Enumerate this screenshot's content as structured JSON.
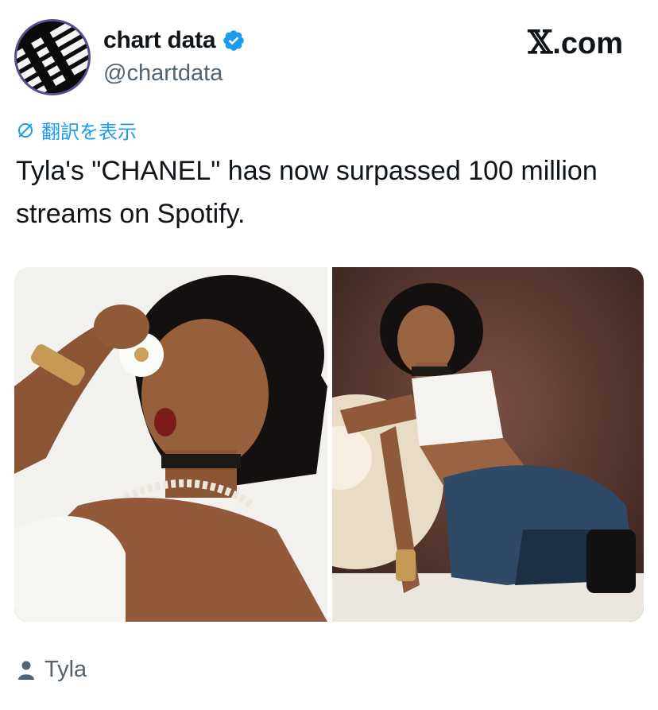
{
  "author": {
    "display_name": "chart data",
    "handle": "@chartdata",
    "verified": true,
    "avatar_icon": "piano-keys-logo-icon"
  },
  "site": {
    "name": ".com",
    "logo_icon": "x-logo-icon"
  },
  "translate": {
    "label": "翻訳を表示",
    "icon": "globe-slash-icon",
    "color": "#1d9bf0"
  },
  "tweet": {
    "text_line_1": "Tyla's \"CHANEL\" has now surpassed 100 million",
    "text_line_2": "streams on Spotify."
  },
  "media": [
    {
      "name": "photo-1",
      "description_icon": "portrait-photo-white-background"
    },
    {
      "name": "photo-2",
      "description_icon": "portrait-photo-dark-background"
    }
  ],
  "tagged": {
    "label": "Tyla",
    "icon": "person-icon"
  },
  "colors": {
    "text_primary": "#0f1419",
    "text_secondary": "#536471",
    "verified": "#1d9bf0"
  }
}
